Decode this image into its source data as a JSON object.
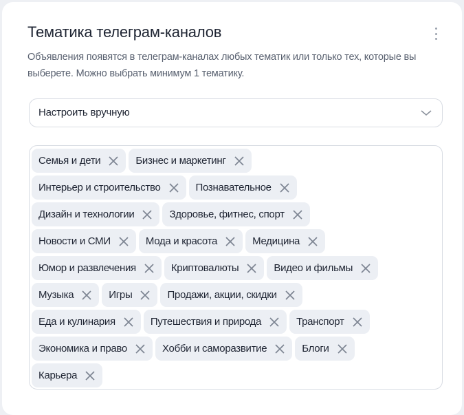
{
  "header": {
    "title": "Тематика телеграм-каналов",
    "description": "Объявления появятся в телеграм-каналах любых тематик или только тех, которые вы выберете. Можно выбрать минимум 1 тематику."
  },
  "select": {
    "value": "Настроить вручную"
  },
  "tag_rows": [
    [
      "Семья и дети",
      "Бизнес и маркетинг"
    ],
    [
      "Интерьер и строительство",
      "Познавательное"
    ],
    [
      "Дизайн и технологии",
      "Здоровье, фитнес, спорт"
    ],
    [
      "Новости и СМИ",
      "Мода и красота",
      "Медицина"
    ],
    [
      "Юмор и развлечения",
      "Криптовалюты",
      "Видео и фильмы"
    ],
    [
      "Музыка",
      "Игры",
      "Продажи, акции, скидки"
    ],
    [
      "Еда и кулинария",
      "Путешествия и природа",
      "Транспорт"
    ],
    [
      "Экономика и право",
      "Хобби и саморазвитие",
      "Блоги"
    ],
    [
      "Карьера"
    ]
  ]
}
